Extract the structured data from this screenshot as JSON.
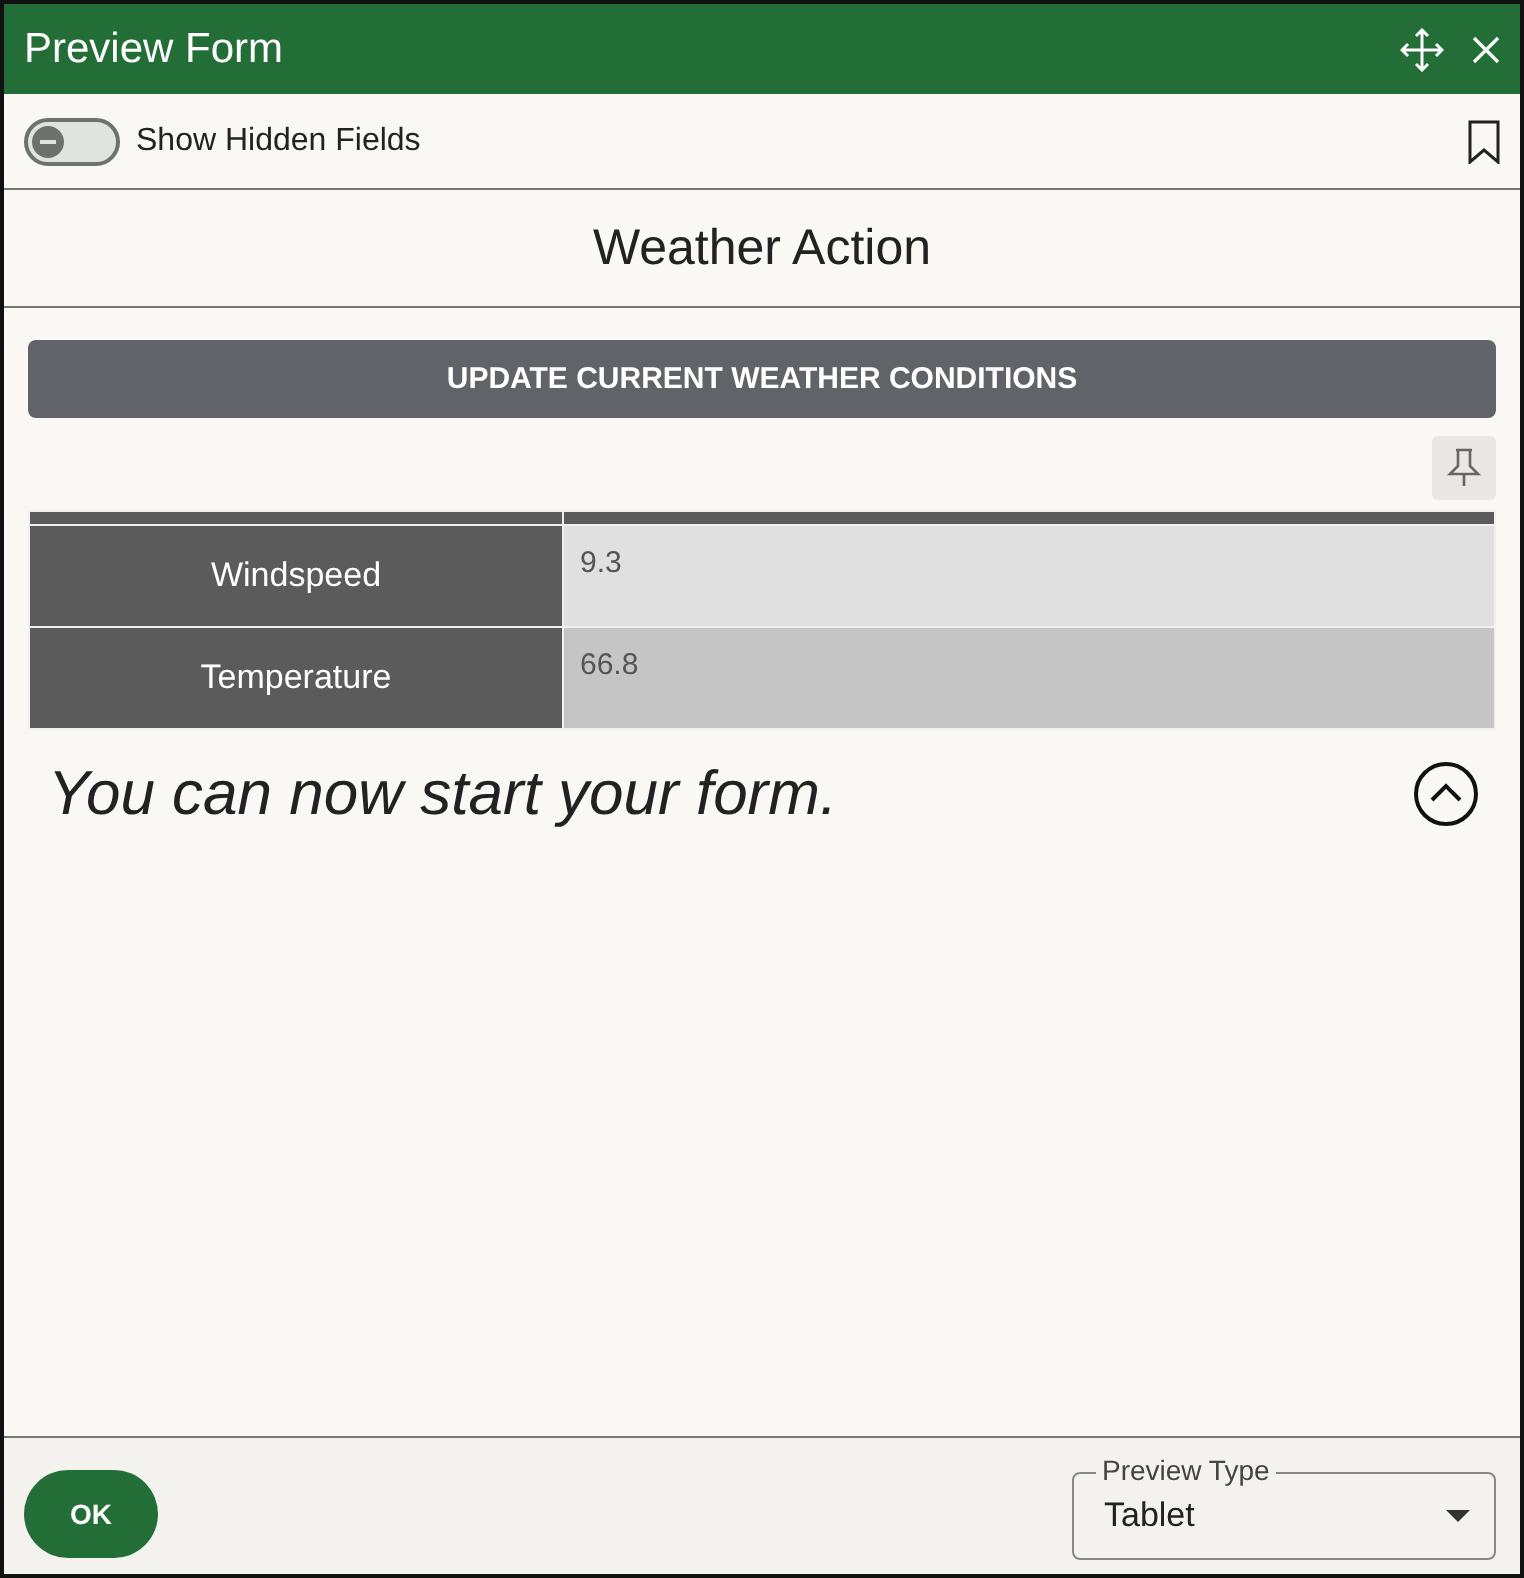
{
  "window": {
    "title": "Preview Form"
  },
  "toolbar": {
    "toggle": {
      "label": "Show Hidden Fields",
      "on": false
    }
  },
  "form": {
    "title": "Weather Action",
    "action_button": "UPDATE CURRENT WEATHER CONDITIONS",
    "table": {
      "rows": [
        {
          "label": "Windspeed",
          "value": "9.3"
        },
        {
          "label": "Temperature",
          "value": "66.8"
        }
      ]
    },
    "section": {
      "title": "You can now start your form.",
      "expanded": true
    }
  },
  "footer": {
    "ok_button": "OK",
    "preview_type": {
      "label": "Preview Type",
      "value": "Tablet"
    }
  }
}
